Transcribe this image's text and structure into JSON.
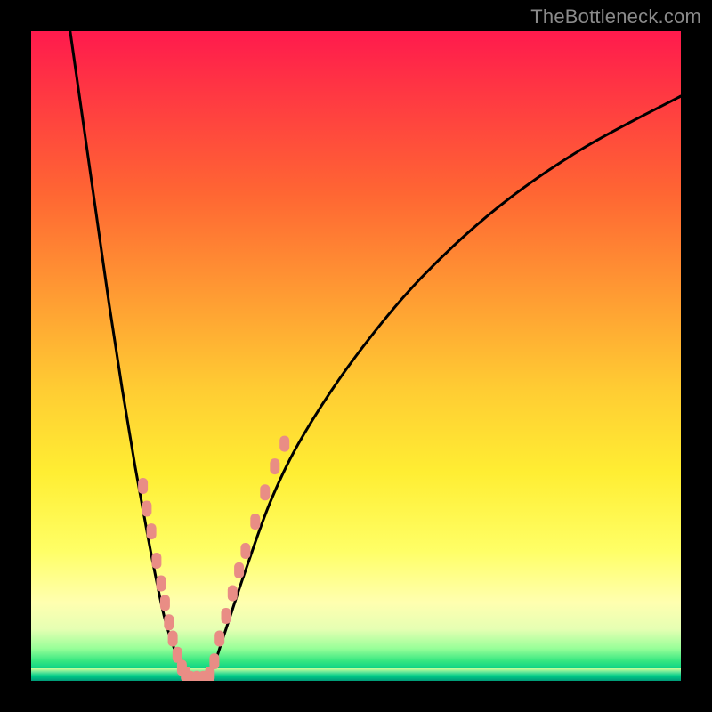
{
  "watermark": {
    "text": "TheBottleneck.com"
  },
  "chart_data": {
    "type": "line",
    "title": "",
    "xlabel": "",
    "ylabel": "",
    "xlim": [
      0,
      100
    ],
    "ylim": [
      0,
      100
    ],
    "grid": false,
    "legend": false,
    "background_gradient": {
      "orientation": "vertical",
      "stops": [
        {
          "pct": 0,
          "color": "#ff1a4d"
        },
        {
          "pct": 25,
          "color": "#ff6633"
        },
        {
          "pct": 55,
          "color": "#ffcc33"
        },
        {
          "pct": 80,
          "color": "#ffff66"
        },
        {
          "pct": 95,
          "color": "#99ff99"
        },
        {
          "pct": 100,
          "color": "#009977"
        }
      ]
    },
    "series": [
      {
        "name": "left-branch",
        "kind": "curve",
        "x": [
          6,
          8,
          10,
          12,
          14,
          16,
          18,
          20,
          21,
          22,
          23,
          24
        ],
        "y": [
          100,
          86,
          72,
          58,
          45,
          33,
          22,
          12,
          8,
          5,
          2,
          0
        ]
      },
      {
        "name": "right-branch",
        "kind": "curve",
        "x": [
          27,
          28,
          30,
          33,
          37,
          42,
          50,
          60,
          72,
          85,
          100
        ],
        "y": [
          0,
          2,
          8,
          17,
          28,
          38,
          50,
          62,
          73,
          82,
          90
        ]
      },
      {
        "name": "dots-left",
        "kind": "dots",
        "color": "#e98d85",
        "x": [
          17.2,
          17.8,
          18.5,
          19.3,
          20.0,
          20.6,
          21.2,
          21.8,
          22.5,
          23.2,
          23.8
        ],
        "y": [
          30.0,
          26.5,
          23.0,
          18.5,
          15.0,
          12.0,
          9.0,
          6.5,
          4.0,
          2.0,
          1.0
        ]
      },
      {
        "name": "dots-right",
        "kind": "dots",
        "color": "#e98d85",
        "x": [
          27.5,
          28.2,
          29.0,
          30.0,
          31.0,
          32.0,
          33.0,
          34.5,
          36.0,
          37.5,
          39.0
        ],
        "y": [
          1.0,
          3.0,
          6.5,
          10.0,
          13.5,
          17.0,
          20.0,
          24.5,
          29.0,
          33.0,
          36.5
        ]
      },
      {
        "name": "dots-valley",
        "kind": "dots",
        "color": "#e98d85",
        "x": [
          24.5,
          25.5,
          26.5
        ],
        "y": [
          0.3,
          0.3,
          0.3
        ]
      }
    ]
  }
}
